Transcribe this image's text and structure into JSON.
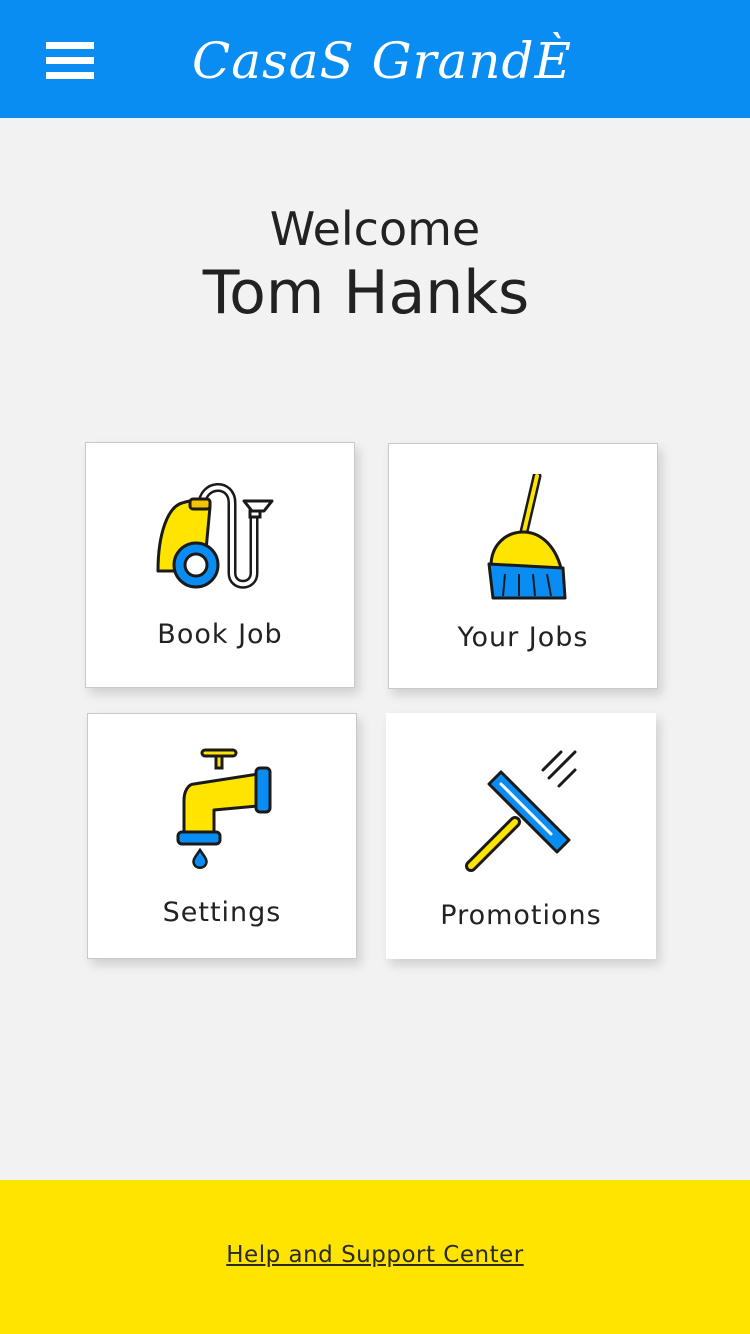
{
  "header": {
    "brand": "CasaS GrandÈ",
    "menu_icon": "hamburger-menu-icon",
    "color": "#0a8df3"
  },
  "welcome": {
    "greeting": "Welcome",
    "user_name": "Tom Hanks"
  },
  "tiles": [
    {
      "label": "Book Job",
      "icon": "vacuum-cleaner-icon"
    },
    {
      "label": "Your Jobs",
      "icon": "broom-icon"
    },
    {
      "label": "Settings",
      "icon": "water-tap-icon"
    },
    {
      "label": "Promotions",
      "icon": "squeegee-icon"
    }
  ],
  "footer": {
    "help_link": "Help and Support Center",
    "color": "#ffe400"
  },
  "colors": {
    "accent_blue": "#0a8df3",
    "accent_yellow": "#ffe400",
    "background": "#f2f2f2"
  }
}
